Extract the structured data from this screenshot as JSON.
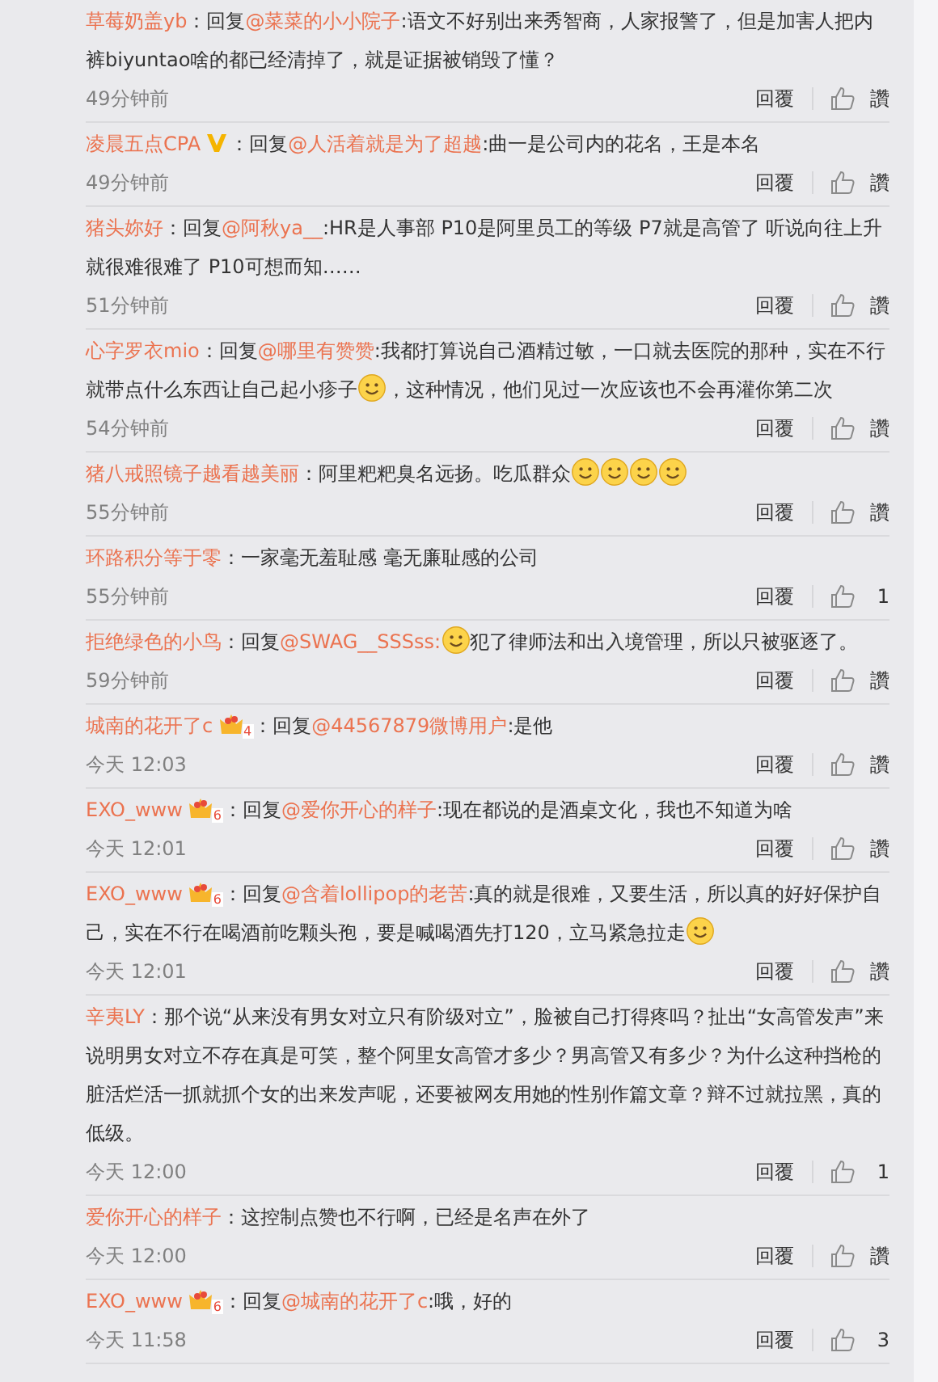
{
  "comments": [
    {
      "user": "草莓奶盖yb",
      "body": [
        {
          "kind": "text",
          "text": "：回复"
        },
        {
          "kind": "mention",
          "text": "@菜菜的小小院子"
        },
        {
          "kind": "text",
          "text": ":语文不好别出来秀智商，人家报警了，但是加害人把内裤biyuntao啥的都已经清掉了，就是证据被销毁了懂？"
        }
      ],
      "time": "49分钟前",
      "reply": "回覆",
      "like": "讚"
    },
    {
      "user": "凌晨五点CPA",
      "badge": {
        "kind": "vip"
      },
      "body": [
        {
          "kind": "text",
          "text": "：回复"
        },
        {
          "kind": "mention",
          "text": "@人活着就是为了超越"
        },
        {
          "kind": "text",
          "text": ":曲一是公司内的花名，王是本名"
        }
      ],
      "time": "49分钟前",
      "reply": "回覆",
      "like": "讚"
    },
    {
      "user": "猪头妳好",
      "body": [
        {
          "kind": "text",
          "text": "：回复"
        },
        {
          "kind": "mention",
          "text": "@阿秋ya__"
        },
        {
          "kind": "text",
          "text": ":HR是人事部 P10是阿里员工的等级 P7就是高管了 听说向往上升就很难很难了  P10可想而知……"
        }
      ],
      "time": "51分钟前",
      "reply": "回覆",
      "like": "讚"
    },
    {
      "user": "心字罗衣mio",
      "body": [
        {
          "kind": "text",
          "text": "：回复"
        },
        {
          "kind": "mention",
          "text": "@哪里有赞赞"
        },
        {
          "kind": "text",
          "text": ":我都打算说自己酒精过敏，一口就去医院的那种，实在不行就带点什么东西让自己起小疹子"
        },
        {
          "kind": "emoji"
        },
        {
          "kind": "text",
          "text": "，这种情况，他们见过一次应该也不会再灌你第二次"
        }
      ],
      "time": "54分钟前",
      "reply": "回覆",
      "like": "讚"
    },
    {
      "user": "猪八戒照镜子越看越美丽",
      "body": [
        {
          "kind": "text",
          "text": "：阿里粑粑臭名远扬。吃瓜群众"
        },
        {
          "kind": "emoji"
        },
        {
          "kind": "emoji"
        },
        {
          "kind": "emoji"
        },
        {
          "kind": "emoji"
        }
      ],
      "time": "55分钟前",
      "reply": "回覆",
      "like": "讚"
    },
    {
      "user": "环路积分等于零",
      "body": [
        {
          "kind": "text",
          "text": "：一家毫无羞耻感 毫无廉耻感的公司"
        }
      ],
      "time": "55分钟前",
      "reply": "回覆",
      "like": "1"
    },
    {
      "user": "拒绝绿色的小鸟",
      "body": [
        {
          "kind": "text",
          "text": "：回复"
        },
        {
          "kind": "mention",
          "text": "@SWAG__SSSss:"
        },
        {
          "kind": "emoji"
        },
        {
          "kind": "text",
          "text": "犯了律师法和出入境管理，所以只被驱逐了。"
        }
      ],
      "time": "59分钟前",
      "reply": "回覆",
      "like": "讚"
    },
    {
      "user": "城南的花开了c",
      "badge": {
        "kind": "crown",
        "text": "4"
      },
      "body": [
        {
          "kind": "text",
          "text": "：回复"
        },
        {
          "kind": "mention",
          "text": "@44567879微博用户"
        },
        {
          "kind": "text",
          "text": ":是他"
        }
      ],
      "time": "今天 12:03",
      "reply": "回覆",
      "like": "讚"
    },
    {
      "user": "EXO_www",
      "badge": {
        "kind": "crown",
        "text": "6"
      },
      "body": [
        {
          "kind": "text",
          "text": "：回复"
        },
        {
          "kind": "mention",
          "text": "@爱你开心的样子"
        },
        {
          "kind": "text",
          "text": ":现在都说的是酒桌文化，我也不知道为啥"
        }
      ],
      "time": "今天 12:01",
      "reply": "回覆",
      "like": "讚"
    },
    {
      "user": "EXO_www",
      "badge": {
        "kind": "crown",
        "text": "6"
      },
      "body": [
        {
          "kind": "text",
          "text": "：回复"
        },
        {
          "kind": "mention",
          "text": "@含着lollipop的老苦"
        },
        {
          "kind": "text",
          "text": ":真的就是很难，又要生活，所以真的好好保护自己，实在不行在喝酒前吃颗头孢，要是喊喝酒先打120，立马紧急拉走"
        },
        {
          "kind": "emoji"
        }
      ],
      "time": "今天 12:01",
      "reply": "回覆",
      "like": "讚"
    },
    {
      "user": "辛夷LY",
      "body": [
        {
          "kind": "text",
          "text": "：那个说“从来没有男女对立只有阶级对立”，脸被自己打得疼吗？扯出“女高管发声”来说明男女对立不存在真是可笑，整个阿里女高管才多少？男高管又有多少？为什么这种挡枪的脏活烂活一抓就抓个女的出来发声呢，还要被网友用她的性别作篇文章？辩不过就拉黑，真的低级。"
        }
      ],
      "time": "今天 12:00",
      "reply": "回覆",
      "like": "1"
    },
    {
      "user": "爱你开心的样子",
      "body": [
        {
          "kind": "text",
          "text": "：这控制点赞也不行啊，已经是名声在外了"
        }
      ],
      "time": "今天 12:00",
      "reply": "回覆",
      "like": "讚"
    },
    {
      "user": "EXO_www",
      "badge": {
        "kind": "crown",
        "text": "6"
      },
      "body": [
        {
          "kind": "text",
          "text": "：回复"
        },
        {
          "kind": "mention",
          "text": "@城南的花开了c"
        },
        {
          "kind": "text",
          "text": ":哦，好的"
        }
      ],
      "time": "今天 11:58",
      "reply": "回覆",
      "like": "3"
    }
  ]
}
